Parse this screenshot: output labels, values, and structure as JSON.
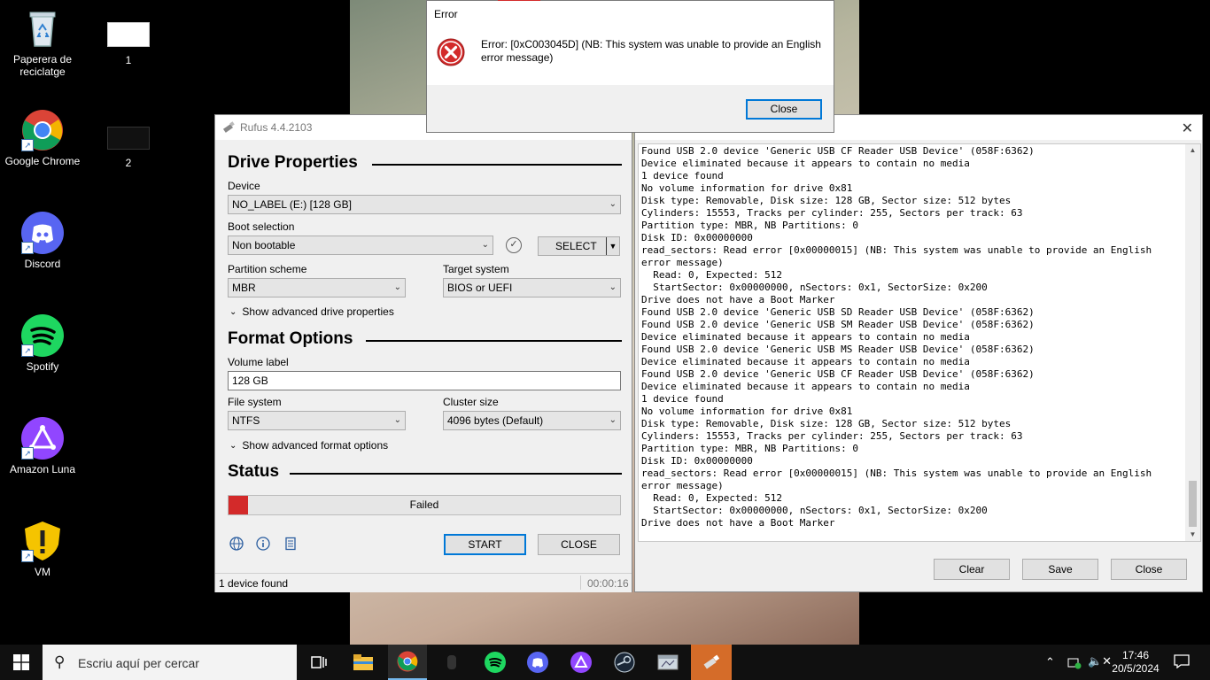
{
  "desktop": {
    "icons": [
      {
        "label": "Paperera de reciclatge",
        "icon": "recycle-bin-icon"
      },
      {
        "label": "1",
        "icon": "document-thumbnail-icon"
      },
      {
        "label": "Google Chrome",
        "icon": "chrome-icon"
      },
      {
        "label": "2",
        "icon": "document-thumbnail-icon"
      },
      {
        "label": "Discord",
        "icon": "discord-icon"
      },
      {
        "label": "Spotify",
        "icon": "spotify-icon"
      },
      {
        "label": "Amazon Luna",
        "icon": "amazon-luna-icon"
      },
      {
        "label": "VM",
        "icon": "warning-shield-icon"
      }
    ]
  },
  "error_dialog": {
    "title": "Error",
    "message_line1": "Error: [0xC003045D] (NB: This system was unable to provide an English",
    "message_line2": "error message)",
    "close_label": "Close",
    "icon": "error-icon"
  },
  "rufus": {
    "title": "Rufus 4.4.2103",
    "drive_properties": "Drive Properties",
    "device_label": "Device",
    "device_value": "NO_LABEL (E:) [128 GB]",
    "boot_label": "Boot selection",
    "boot_value": "Non bootable",
    "select_label": "SELECT",
    "partition_label": "Partition scheme",
    "partition_value": "MBR",
    "target_label": "Target system",
    "target_value": "BIOS or UEFI",
    "adv_drive": "Show advanced drive properties",
    "format_options": "Format Options",
    "volume_label": "Volume label",
    "volume_value": "128 GB",
    "fs_label": "File system",
    "fs_value": "NTFS",
    "cluster_label": "Cluster size",
    "cluster_value": "4096 bytes (Default)",
    "adv_format": "Show advanced format options",
    "status_head": "Status",
    "status_text": "Failed",
    "progress": 0.05,
    "start_label": "START",
    "close_label": "CLOSE",
    "statusbar_left": "1 device found",
    "statusbar_right": "00:00:16"
  },
  "log": {
    "lines": "Found USB 2.0 device 'Generic USB CF Reader USB Device' (058F:6362)\nDevice eliminated because it appears to contain no media\n1 device found\nNo volume information for drive 0x81\nDisk type: Removable, Disk size: 128 GB, Sector size: 512 bytes\nCylinders: 15553, Tracks per cylinder: 255, Sectors per track: 63\nPartition type: MBR, NB Partitions: 0\nDisk ID: 0x00000000\nread_sectors: Read error [0x00000015] (NB: This system was unable to provide an English error message)\n  Read: 0, Expected: 512\n  StartSector: 0x00000000, nSectors: 0x1, SectorSize: 0x200\nDrive does not have a Boot Marker\nFound USB 2.0 device 'Generic USB SD Reader USB Device' (058F:6362)\nFound USB 2.0 device 'Generic USB SM Reader USB Device' (058F:6362)\nDevice eliminated because it appears to contain no media\nFound USB 2.0 device 'Generic USB MS Reader USB Device' (058F:6362)\nDevice eliminated because it appears to contain no media\nFound USB 2.0 device 'Generic USB CF Reader USB Device' (058F:6362)\nDevice eliminated because it appears to contain no media\n1 device found\nNo volume information for drive 0x81\nDisk type: Removable, Disk size: 128 GB, Sector size: 512 bytes\nCylinders: 15553, Tracks per cylinder: 255, Sectors per track: 63\nPartition type: MBR, NB Partitions: 0\nDisk ID: 0x00000000\nread_sectors: Read error [0x00000015] (NB: This system was unable to provide an English error message)\n  Read: 0, Expected: 512\n  StartSector: 0x00000000, nSectors: 0x1, SectorSize: 0x200\nDrive does not have a Boot Marker",
    "clear_label": "Clear",
    "save_label": "Save",
    "close_label": "Close"
  },
  "taskbar": {
    "search_placeholder": "Escriu aquí per cercar",
    "time": "17:46",
    "date": "20/5/2024",
    "apps": [
      "task-view-icon",
      "file-explorer-icon",
      "chrome-icon",
      "app-icon",
      "spotify-icon",
      "discord-icon",
      "amazon-luna-icon",
      "steam-icon",
      "window-icon",
      "rufus-icon"
    ]
  }
}
